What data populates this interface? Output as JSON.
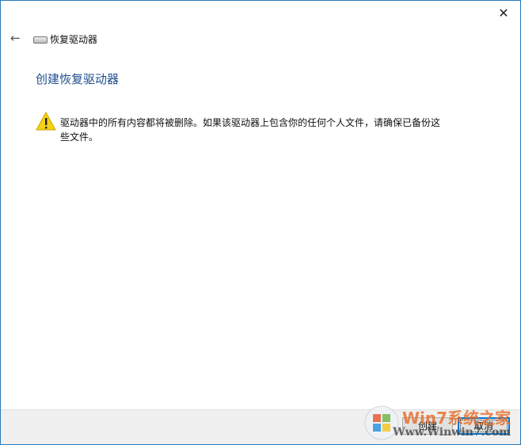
{
  "header": {
    "title": "恢复驱动器",
    "close_label": "✕",
    "back_label": "←"
  },
  "main": {
    "heading": "创建恢复驱动器",
    "warning": "驱动器中的所有内容都将被删除。如果该驱动器上包含你的任何个人文件，请确保已备份这些文件。"
  },
  "footer": {
    "create_label": "创建",
    "cancel_label": "取消"
  },
  "watermark": {
    "line1": "Win7系统之家",
    "line2": "Www.Winwin7.com"
  }
}
